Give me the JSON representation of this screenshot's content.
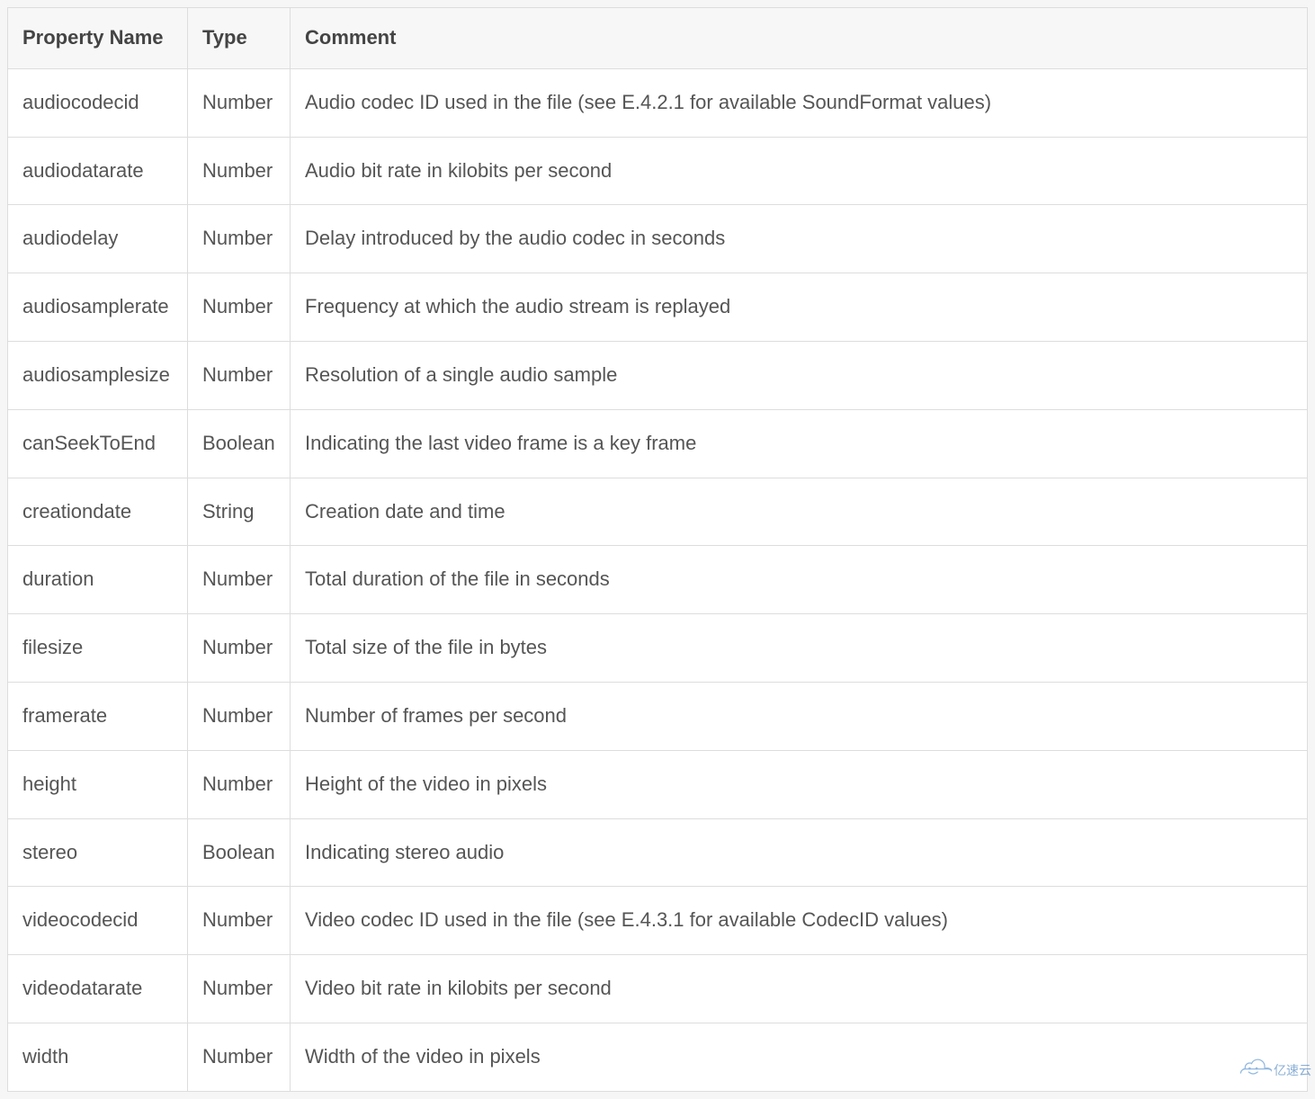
{
  "table": {
    "headers": {
      "property": "Property Name",
      "type": "Type",
      "comment": "Comment"
    },
    "rows": [
      {
        "property": "audiocodecid",
        "type": "Number",
        "comment": "Audio codec ID used in the file (see E.4.2.1 for available SoundFormat values)"
      },
      {
        "property": "audiodatarate",
        "type": "Number",
        "comment": "Audio bit rate in kilobits per second"
      },
      {
        "property": "audiodelay",
        "type": "Number",
        "comment": "Delay introduced by the audio codec in seconds"
      },
      {
        "property": "audiosamplerate",
        "type": "Number",
        "comment": "Frequency at which the audio stream is replayed"
      },
      {
        "property": "audiosamplesize",
        "type": "Number",
        "comment": "Resolution of a single audio sample"
      },
      {
        "property": "canSeekToEnd",
        "type": "Boolean",
        "comment": "Indicating the last video frame is a key frame"
      },
      {
        "property": "creationdate",
        "type": "String",
        "comment": "Creation date and time"
      },
      {
        "property": "duration",
        "type": "Number",
        "comment": "Total duration of the file in seconds"
      },
      {
        "property": "filesize",
        "type": "Number",
        "comment": "Total size of the file in bytes"
      },
      {
        "property": "framerate",
        "type": "Number",
        "comment": "Number of frames per second"
      },
      {
        "property": "height",
        "type": "Number",
        "comment": "Height of the video in pixels"
      },
      {
        "property": "stereo",
        "type": "Boolean",
        "comment": "Indicating stereo audio"
      },
      {
        "property": "videocodecid",
        "type": "Number",
        "comment": "Video codec ID used in the file (see E.4.3.1 for available CodecID values)"
      },
      {
        "property": "videodatarate",
        "type": "Number",
        "comment": "Video bit rate in kilobits per second"
      },
      {
        "property": "width",
        "type": "Number",
        "comment": "Width of the video in pixels"
      }
    ]
  },
  "watermark": {
    "text": "亿速云"
  }
}
